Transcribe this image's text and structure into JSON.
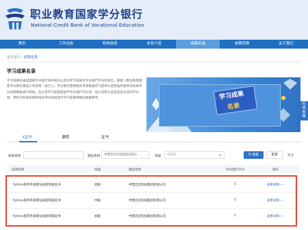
{
  "header": {
    "title": "职业教育国家学分银行",
    "subtitle": "National Credit Bank of Vocational Education"
  },
  "nav": {
    "items": [
      {
        "label": "首页"
      },
      {
        "label": "工作动态"
      },
      {
        "label": "机构信息"
      },
      {
        "label": "业务介绍"
      },
      {
        "label": "成果名录"
      },
      {
        "label": "成果转换"
      },
      {
        "label": "关于我们"
      }
    ],
    "active_index": 4
  },
  "breadcrumb": {
    "home": "首页首页",
    "separator": "/",
    "current": "成果名录"
  },
  "section": {
    "title": "学习成果名录",
    "intro": "学习成果名录是国家学分银行发布相对认定的学习成果及学分银行学分的窗口。根据《职业教育国家学分银行建设工作指南（试行）》，学分银行需要组织专家依据学习成果认定标准和程序对拟录学分成果数据进行审核，在认定学习成果后给予学分银行学分登，经认定积认证后及其对应的学分登，用作为有关院校和培训评价组织进行学习成果转换的依据参考。"
  },
  "banner": {
    "line1": "学习成果",
    "line2": "名录"
  },
  "side_tab": {
    "label": "在线客服"
  },
  "tabs": {
    "items": [
      {
        "label": "X证书"
      },
      {
        "label": "课程"
      },
      {
        "label": "证书"
      }
    ],
    "active_index": 0
  },
  "filters": {
    "name_label": "成果名称",
    "name_placeholder": "",
    "org_label": "颁证机构",
    "org_value": "中慧云启科技集团有限公",
    "level_label": "等级",
    "level_placeholder": "请选择",
    "search_label": "Q 搜索",
    "reset_label": "重置",
    "more_label": "更多"
  },
  "table": {
    "columns": [
      "成果名称",
      "等级",
      "颁证机构",
      "学分银行学分",
      "操作"
    ],
    "rows": [
      {
        "name": "Python程序开发职业技能等级证书",
        "level": "高级",
        "org": "中慧云启科技集团有限公司",
        "credits": "5",
        "action": "查看详情 →"
      },
      {
        "name": "Python程序开发职业技能等级证书",
        "level": "中级",
        "org": "中慧云启科技集团有限公司",
        "credits": "5",
        "action": "查看详情 →"
      },
      {
        "name": "Python程序开发职业技能等级证书",
        "level": "初级",
        "org": "中慧云启科技集团有限公司",
        "credits": "5",
        "action": "查看详情 →"
      }
    ]
  },
  "colors": {
    "brand": "#1f6fc2",
    "nav_active": "#5b9dde",
    "link": "#2f73c4",
    "highlight_box": "#e8442f"
  }
}
